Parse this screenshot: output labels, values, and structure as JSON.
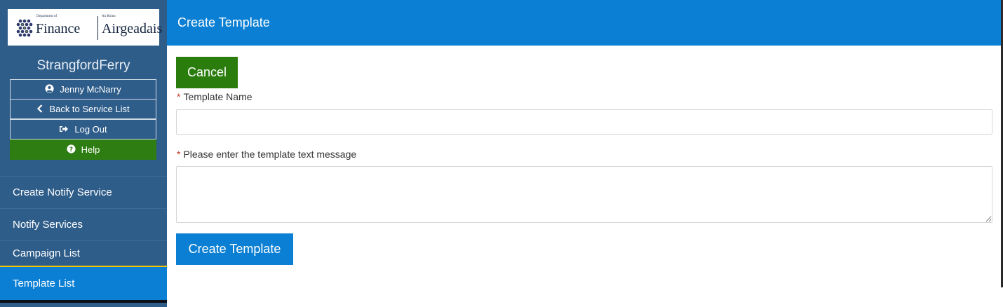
{
  "logo": {
    "dept_small": "Department of",
    "dept_big": "Finance",
    "irish_small": "An Roinn",
    "irish_big": "Airgeadais"
  },
  "sidebar": {
    "service_name": "StrangfordFerry",
    "user_name": "Jenny McNarry",
    "back_label": "Back to Service List",
    "logout_label": "Log Out",
    "help_label": "Help",
    "items": [
      {
        "label": "Create Notify Service"
      },
      {
        "label": "Notify Services"
      },
      {
        "label": "Campaign List"
      },
      {
        "label": "Template List",
        "active": true
      }
    ]
  },
  "header": {
    "title": "Create Template"
  },
  "form": {
    "cancel_label": "Cancel",
    "name_label": "Template Name",
    "name_value": "",
    "message_label": "Please enter the template text message",
    "message_value": "",
    "required_marker": "*",
    "submit_label": "Create Template"
  },
  "icons": {
    "user": "user-circle-icon",
    "back": "chevron-left-icon",
    "logout": "sign-out-icon",
    "help": "question-circle-icon"
  },
  "colors": {
    "primary": "#0a7fd3",
    "sidebar": "#2f5d8a",
    "success": "#2a7d0d",
    "active_indicator": "#f5c400"
  }
}
